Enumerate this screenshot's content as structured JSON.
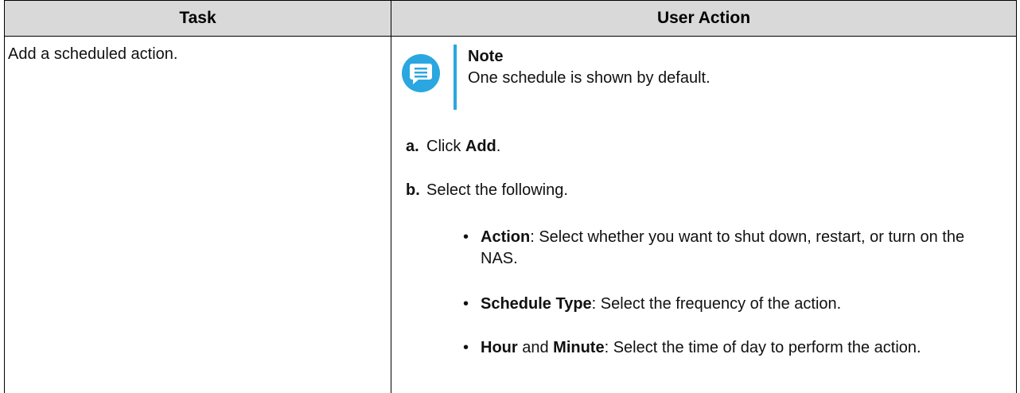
{
  "table": {
    "headers": {
      "task": "Task",
      "user_action": "User Action"
    },
    "rows": [
      {
        "task": "Add a scheduled action.",
        "note": {
          "icon": "note-icon",
          "title": "Note",
          "text": "One schedule is shown by default."
        },
        "steps": [
          {
            "marker": "a.",
            "pre": "Click ",
            "bold": "Add",
            "post": "."
          },
          {
            "marker": "b.",
            "text": "Select the following."
          }
        ],
        "bullets": [
          {
            "bold": "Action",
            "text": ": Select whether you want to shut down, restart, or turn on the NAS."
          },
          {
            "bold": "Schedule Type",
            "text": ": Select the frequency of the action."
          },
          {
            "bold": "Hour",
            "mid": " and ",
            "bold2": "Minute",
            "text": ": Select the time of day to perform the action."
          }
        ]
      }
    ]
  },
  "colors": {
    "header_bg": "#d9d9d9",
    "note_accent": "#2aa7e0"
  }
}
